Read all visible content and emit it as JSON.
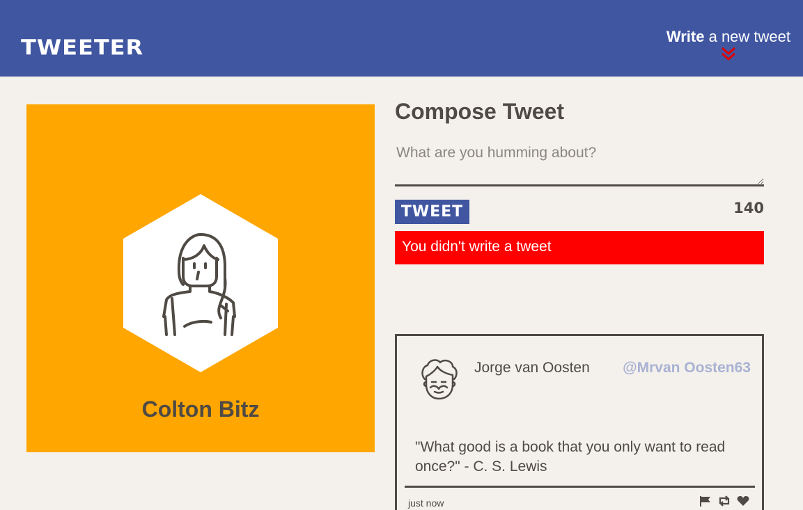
{
  "nav": {
    "logo": "TWEETER",
    "write_bold": "Write",
    "write_rest": " a new tweet"
  },
  "profile": {
    "name": "Colton Bitz",
    "background_color": "#ffa600"
  },
  "compose": {
    "title": "Compose Tweet",
    "placeholder": "What are you humming about?",
    "button_label": "TWEET",
    "counter": "140",
    "error": "You didn't write a tweet"
  },
  "tweet": {
    "author": "Jorge van Oosten",
    "handle": "@Mrvan Oosten63",
    "text": "\"What good is a book that you only want to read once?\" - C. S. Lewis",
    "time": "just now"
  },
  "colors": {
    "nav": "#4056a1",
    "accent": "#ff0000",
    "background": "#f4f1ec",
    "text": "#4f4a44"
  }
}
